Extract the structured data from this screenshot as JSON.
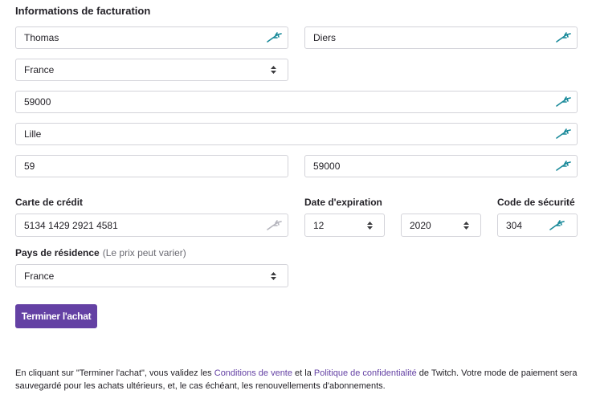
{
  "billing": {
    "title": "Informations de facturation",
    "first_name": "Thomas",
    "last_name": "Diers",
    "country": "France",
    "address": "59000",
    "city": "Lille",
    "region": "59",
    "postal_code": "59000"
  },
  "card": {
    "label": "Carte de crédit",
    "number": "5134 1429 2921 4581"
  },
  "expiration": {
    "label": "Date d'expiration",
    "month": "12",
    "year": "2020"
  },
  "security": {
    "label": "Code de sécurité",
    "code": "304"
  },
  "residence": {
    "label": "Pays de résidence",
    "hint": "(Le prix peut varier)",
    "country": "France"
  },
  "submit_label": "Terminer l'achat",
  "legal": {
    "part1": "En cliquant sur \"Terminer l'achat\", vous validez les ",
    "link1": "Conditions de vente",
    "part2": " et la ",
    "link2": "Politique de confidentialité",
    "part3": " de Twitch. Votre mode de paiement sera sauvegardé pour les achats ultérieurs, et, le cas échéant, les renouvellements d'abonnements."
  },
  "icons": {
    "autofill": "autofill-icon",
    "select": "select-arrows-icon"
  },
  "colors": {
    "accent": "#6441a4",
    "autofill": "#1a8a9a",
    "autofill_muted": "#b5b5bd"
  }
}
